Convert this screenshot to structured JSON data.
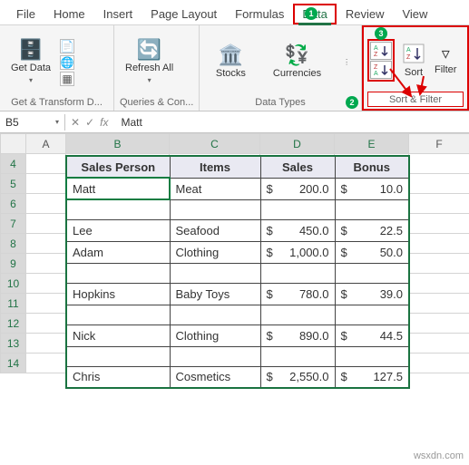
{
  "tabs": [
    "File",
    "Home",
    "Insert",
    "Page Layout",
    "Formulas",
    "Data",
    "Review",
    "View"
  ],
  "tab_active_index": 5,
  "callouts": {
    "one": "1",
    "two": "2",
    "three": "3"
  },
  "ribbon": {
    "getdata": {
      "label": "Get Data",
      "group": "Get & Transform D..."
    },
    "refresh": {
      "label": "Refresh All",
      "group": "Queries & Con..."
    },
    "datatypes": {
      "stocks": "Stocks",
      "curr": "Currencies",
      "group": "Data Types"
    },
    "sort": {
      "az": "A→Z",
      "za": "Z→A",
      "sort": "Sort",
      "filter": "Filter",
      "group": "Sort & Filter"
    }
  },
  "namebox": "B5",
  "fx": "fx",
  "formula": "Matt",
  "cols": [
    "",
    "A",
    "B",
    "C",
    "D",
    "E",
    "F"
  ],
  "headers": {
    "sp": "Sales Person",
    "it": "Items",
    "sa": "Sales",
    "bo": "Bonus"
  },
  "rows": [
    {
      "sp": "Matt",
      "it": "Meat",
      "sa": "200.0",
      "bo": "10.0"
    },
    null,
    {
      "sp": "Lee",
      "it": "Seafood",
      "sa": "450.0",
      "bo": "22.5"
    },
    {
      "sp": "Adam",
      "it": "Clothing",
      "sa": "1,000.0",
      "bo": "50.0"
    },
    null,
    {
      "sp": "Hopkins",
      "it": "Baby Toys",
      "sa": "780.0",
      "bo": "39.0"
    },
    null,
    {
      "sp": "Nick",
      "it": "Clothing",
      "sa": "890.0",
      "bo": "44.5"
    },
    null,
    {
      "sp": "Chris",
      "it": "Cosmetics",
      "sa": "2,550.0",
      "bo": "127.5"
    }
  ],
  "watermark": "wsxdn.com"
}
